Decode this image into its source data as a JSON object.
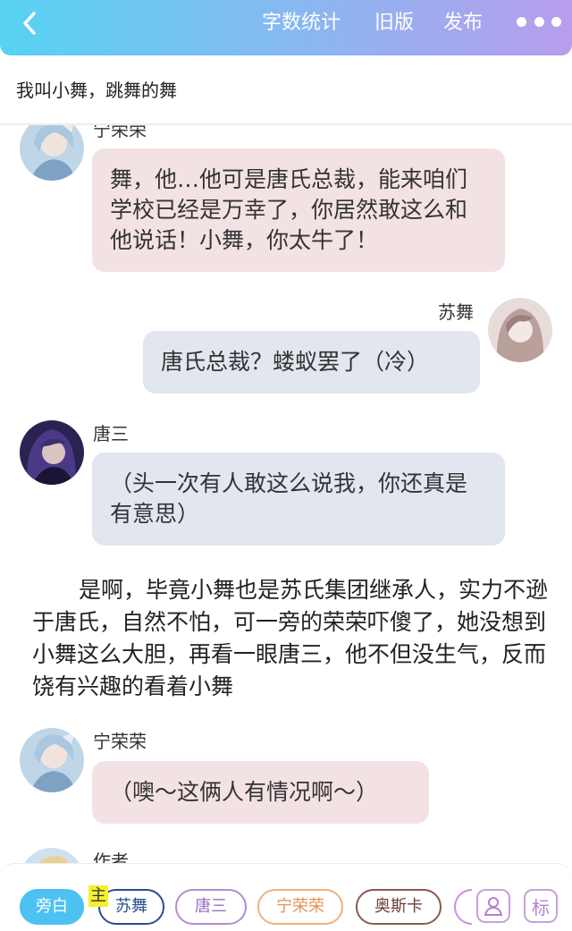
{
  "header": {
    "back_icon": "chevron-left-icon",
    "actions": [
      {
        "label": "字数统计"
      },
      {
        "label": "旧版"
      },
      {
        "label": "发布"
      }
    ],
    "more_icon": "more-dots-icon",
    "colors": {
      "gradient_start": "#57d3f2",
      "gradient_end": "#b79ded"
    }
  },
  "chapter": {
    "title": "我叫小舞，跳舞的舞"
  },
  "messages": [
    {
      "speaker": "宁荣荣",
      "text": "舞，他…他可是唐氏总裁，能来咱们学校已经是万幸了，你居然敢这么和他说话！小舞，你太牛了！",
      "side": "left",
      "bubble_color": "#f3e2e4"
    },
    {
      "speaker": "苏舞",
      "text": "唐氏总裁？蝼蚁罢了（冷）",
      "side": "right",
      "bubble_color": "#e1e6ef"
    },
    {
      "speaker": "唐三",
      "text": "（头一次有人敢这么说我，你还真是有意思）",
      "side": "left",
      "bubble_color": "#e1e6ef"
    },
    {
      "speaker": "宁荣荣",
      "text": "（噢～这俩人有情况啊～）",
      "side": "left",
      "bubble_color": "#f3e2e4"
    },
    {
      "speaker": "作者",
      "text": "",
      "side": "left"
    }
  ],
  "narration": "是啊，毕竟小舞也是苏氏集团继承人，实力不逊于唐氏，自然不怕，可一旁的荣荣吓傻了，她没想到小舞这么大胆，再看一眼唐三，他不但没生气，反而饶有兴趣的看着小舞",
  "bottom_bar": {
    "chips": [
      {
        "label": "旁白",
        "active": true
      },
      {
        "label": "苏舞"
      },
      {
        "label": "唐三"
      },
      {
        "label": "宁荣荣"
      },
      {
        "label": "奥斯卡"
      }
    ],
    "main_tag": "主",
    "tools": [
      {
        "icon": "person-icon"
      },
      {
        "label": "标"
      }
    ]
  }
}
